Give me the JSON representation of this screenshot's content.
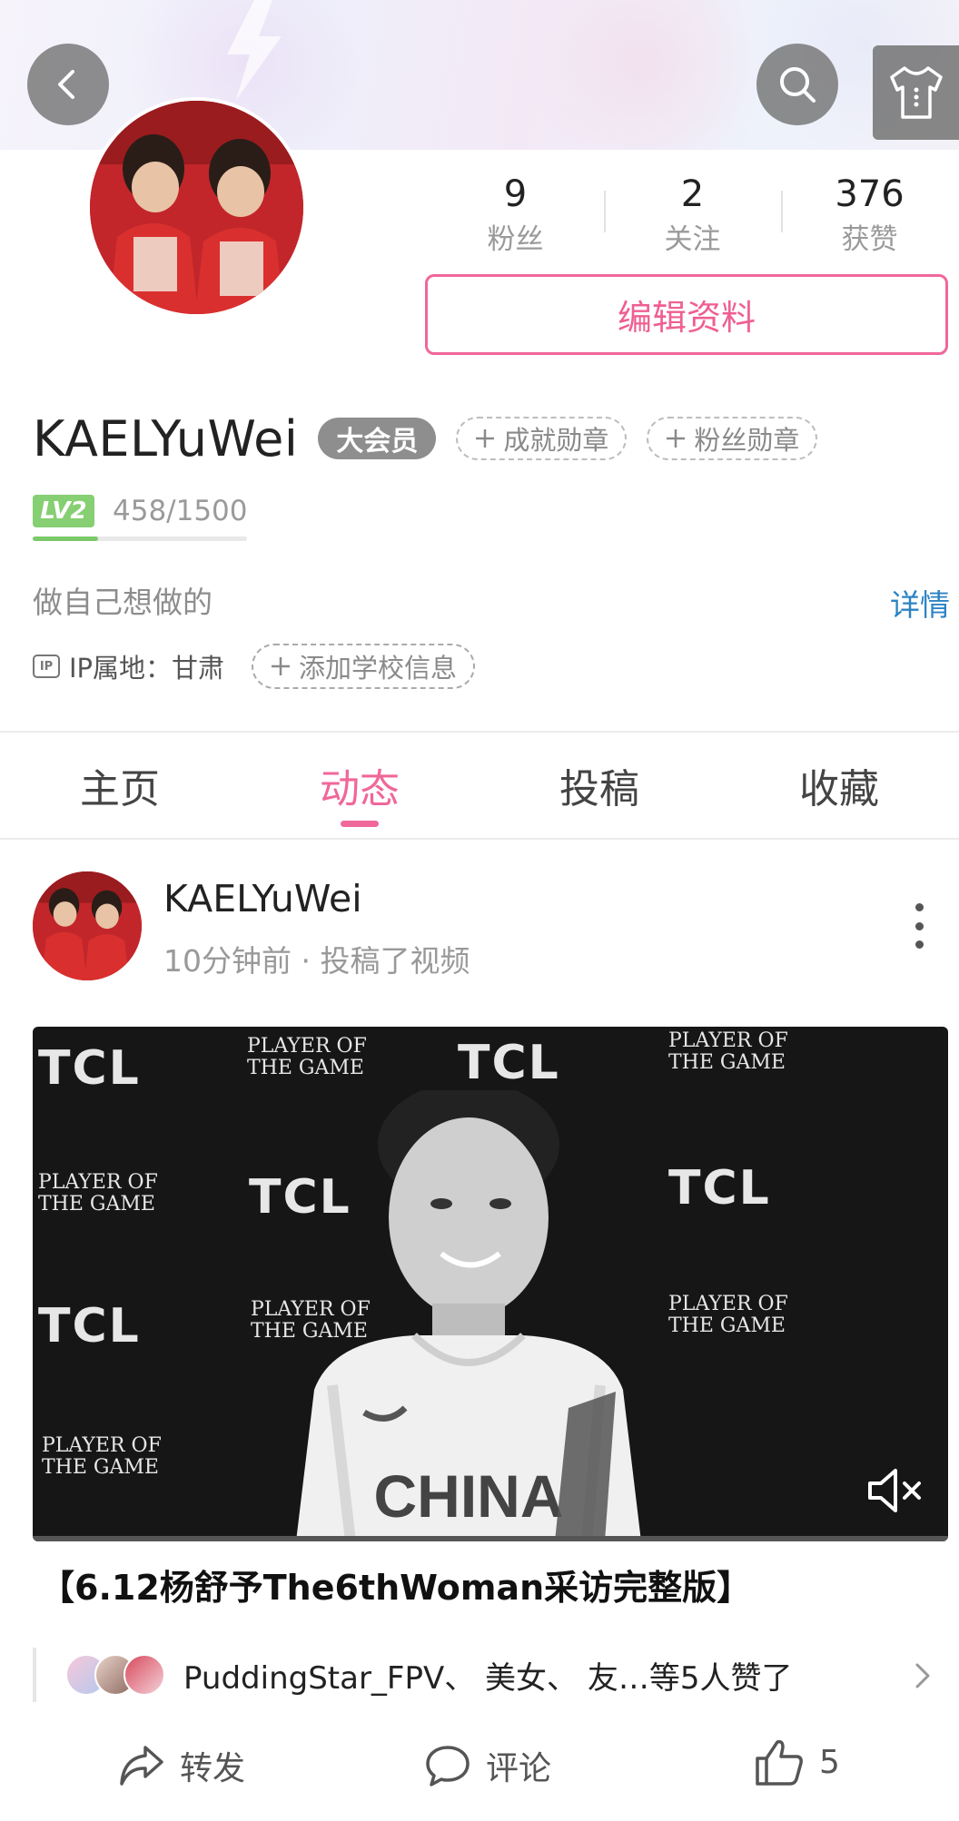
{
  "header": {
    "back_icon": "back-arrow-icon",
    "search_icon": "search-icon",
    "outfit_icon": "tshirt-icon"
  },
  "profile": {
    "stats": [
      {
        "value": "9",
        "label": "粉丝"
      },
      {
        "value": "2",
        "label": "关注"
      },
      {
        "value": "376",
        "label": "获赞"
      }
    ],
    "edit_button": "编辑资料",
    "username": "KAELYuWei",
    "vip_badge": "大会员",
    "medals": [
      "成就勋章",
      "粉丝勋章"
    ],
    "level": {
      "badge": "LV2",
      "progress_text": "458/1500",
      "progress_fraction": 0.305
    },
    "bio": "做自己想做的",
    "detail_link": "详情",
    "ip": {
      "icon_text": "IP",
      "text": "IP属地：甘肃"
    },
    "school_button": "添加学校信息"
  },
  "tabs": [
    {
      "label": "主页",
      "active": false
    },
    {
      "label": "动态",
      "active": true
    },
    {
      "label": "投稿",
      "active": false
    },
    {
      "label": "收藏",
      "active": false
    }
  ],
  "post": {
    "author": "KAELYuWei",
    "time": "10分钟前",
    "action": "投稿了视频",
    "video_title": "【6.12杨舒予The6thWoman采访完整版】",
    "video_bg_words": {
      "brand": "TCL",
      "award_line1": "PLAYER OF",
      "award_line2": "THE GAME",
      "jersey": "CHINA"
    },
    "likes_text": "PuddingStar_FPV、 美女、 友…等5人赞了",
    "actions": [
      {
        "icon": "share-icon",
        "label": "转发"
      },
      {
        "icon": "comment-icon",
        "label": "评论"
      },
      {
        "icon": "thumbs-up-icon",
        "label": "5"
      }
    ]
  },
  "colors": {
    "accent_pink": "#f0679a",
    "link_blue": "#2d83c3",
    "level_green": "#86cf72",
    "vip_gray": "#8e8e8e"
  }
}
